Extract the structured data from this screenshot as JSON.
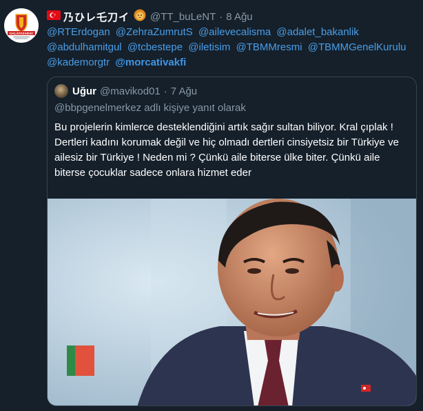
{
  "tweet": {
    "avatar_text": "GALATASARAY",
    "display_name": "乃ひレ乇刀イ",
    "handle": "@TT_buLeNT",
    "separator": "·",
    "date": "8 Ağu",
    "mentions": [
      "@RTErdogan",
      "@ZehraZumrutS",
      "@ailevecalisma",
      "@adalet_bakanlik",
      "@abdulhamitgul",
      "@tcbestepe",
      "@iletisim",
      "@TBMMresmi",
      "@TBMMGenelKurulu",
      "@kademorgtr",
      "@morcativakfi"
    ]
  },
  "quote": {
    "name": "Uğur",
    "handle": "@mavikod01",
    "separator": "·",
    "date": "7 Ağu",
    "reply_to": "@bbpgenelmerkez adlı kişiye yanıt olarak",
    "text_1": "Bu projelerin kimlerce desteklendiğini artık sağır sultan biliyor. Kral çıplak !",
    "text_2": "Dertleri kadını korumak değil ve hiç olmadı dertleri cinsiyetsiz bir Türkiye ve ailesiz bir Türkiye ! Neden mi ? Çünkü aile biterse ülke biter. Çünkü aile biterse çocuklar sadece onlara hizmet eder"
  },
  "colors": {
    "background": "#15202b",
    "link": "#4a9ee8",
    "muted": "#8899a6",
    "border": "#38444d"
  }
}
